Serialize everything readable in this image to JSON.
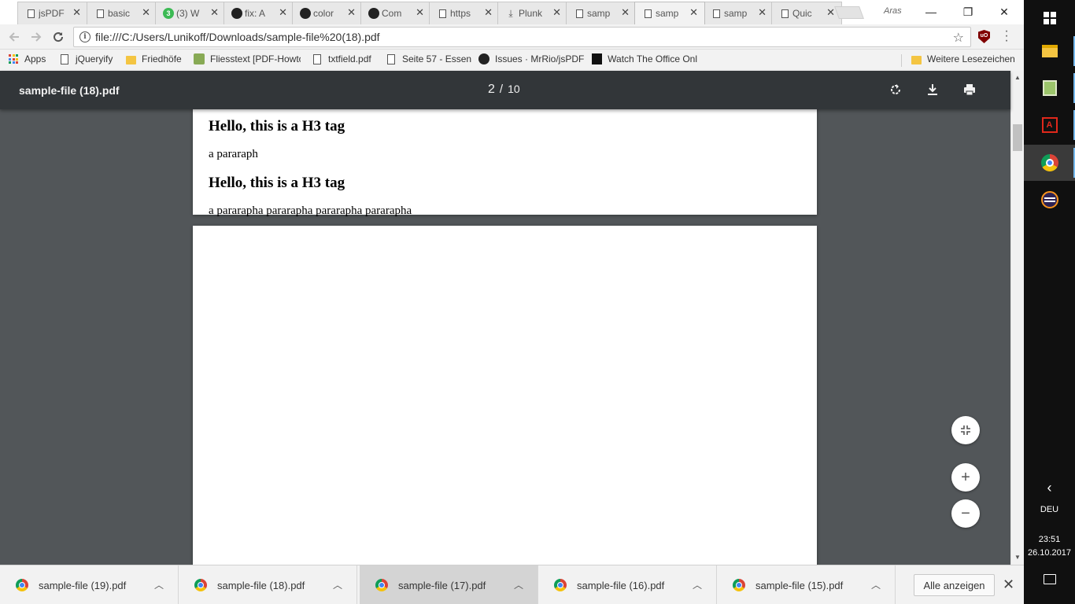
{
  "tabs": [
    {
      "title": "jsPDF",
      "icon": "page"
    },
    {
      "title": "basic",
      "icon": "page"
    },
    {
      "title": "(3) W",
      "icon": "badge",
      "badge": "3"
    },
    {
      "title": "fix: A",
      "icon": "github"
    },
    {
      "title": "color",
      "icon": "github"
    },
    {
      "title": "Com",
      "icon": "github"
    },
    {
      "title": "https",
      "icon": "page"
    },
    {
      "title": "Plunk",
      "icon": "download"
    },
    {
      "title": "samp",
      "icon": "page"
    },
    {
      "title": "samp",
      "icon": "page",
      "active": true
    },
    {
      "title": "samp",
      "icon": "page"
    },
    {
      "title": "Quic",
      "icon": "page"
    }
  ],
  "tab_close_glyph": "✕",
  "profile_name": "Aras",
  "window_controls": {
    "minimize": "—",
    "restore": "❐",
    "close": "✕"
  },
  "toolbar": {
    "url": "file:///C:/Users/Lunikoff/Downloads/sample-file%20(18).pdf",
    "info_glyph": "i",
    "star_glyph": "☆",
    "ublock_label": "uO"
  },
  "bookmarks": [
    {
      "label": "Apps",
      "icon": "apps"
    },
    {
      "label": "jQueryify",
      "icon": "page"
    },
    {
      "label": "Friedhöfe",
      "icon": "folder"
    },
    {
      "label": "Fliesstext [PDF-Howto",
      "icon": "fliess"
    },
    {
      "label": "txtfield.pdf",
      "icon": "page"
    },
    {
      "label": "Seite 57 - Essen",
      "icon": "page"
    },
    {
      "label": "Issues · MrRio/jsPDF",
      "icon": "github"
    },
    {
      "label": "Watch The Office Onl",
      "icon": "office"
    },
    {
      "label": "Weitere Lesezeichen",
      "icon": "folder"
    }
  ],
  "pdf": {
    "filename": "sample-file (18).pdf",
    "current_page": "2",
    "separator": "/",
    "total_pages": "10",
    "page1": {
      "heading1": "Hello, this is a H3 tag",
      "para1": "a pararaph",
      "heading2": "Hello, this is a H3 tag",
      "para2": "a pararapha pararapha pararapha pararapha"
    },
    "fab": {
      "fit": "⤡",
      "zoom_in": "+",
      "zoom_out": "−"
    }
  },
  "downloads": [
    {
      "name": "sample-file (19).pdf"
    },
    {
      "name": "sample-file (18).pdf"
    },
    {
      "name": "sample-file (17).pdf",
      "hover": true
    },
    {
      "name": "sample-file (16).pdf"
    },
    {
      "name": "sample-file (15).pdf"
    }
  ],
  "shelf": {
    "show_all": "Alle anzeigen",
    "close": "✕",
    "caret": "^"
  },
  "taskbar": {
    "lang": "DEU",
    "time": "23:51",
    "date": "26.10.2017",
    "chevron": "‹",
    "apps": [
      "file-explorer",
      "notepad-plus",
      "adobe-reader",
      "chrome",
      "eclipse"
    ]
  }
}
